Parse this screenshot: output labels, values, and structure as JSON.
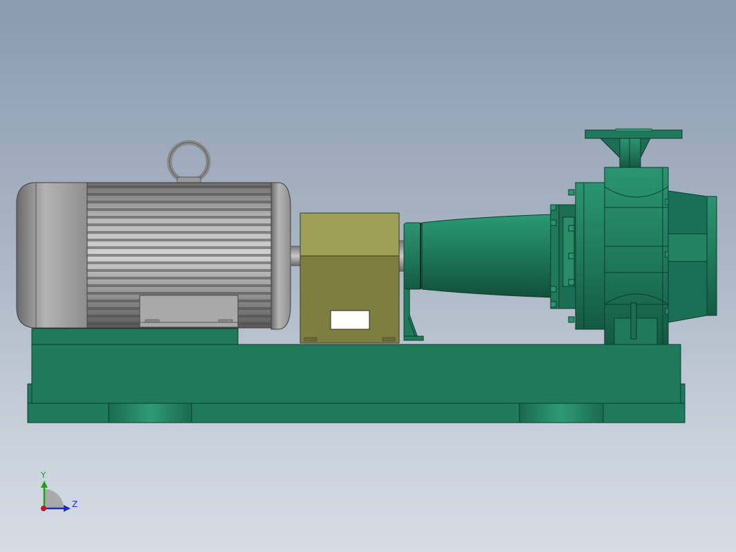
{
  "axis_triad": {
    "y_label": "Y",
    "z_label": "Z",
    "y_color": "#1aa01a",
    "z_color": "#1a2fbf",
    "x_color": "#c01818"
  },
  "colors": {
    "background_top": "#8a9bb0",
    "background_bottom": "#d6dce4",
    "pump_green": "#1f7a5c",
    "motor_grey": "#9a9a9a",
    "bearing_olive": "#7e7f3e"
  }
}
